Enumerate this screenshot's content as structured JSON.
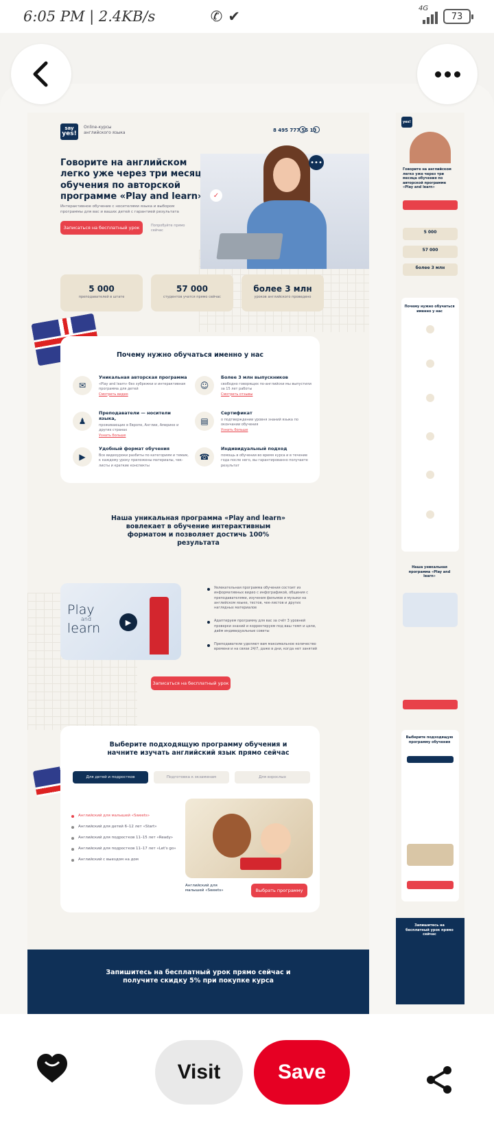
{
  "status_bar": {
    "time": "6:05 PM | 2.4KB/s",
    "network": "4G",
    "battery": "73"
  },
  "desktop": {
    "logo": {
      "top": "say",
      "bottom": "yes!"
    },
    "logo_text": "Online-курсы английского языка",
    "phone": "8 495 777 55 13",
    "hero_title": "Говорите на английском легко уже через три месяца обучения по авторской программе «Play and learn»",
    "hero_subtitle": "Интерактивное обучение с носителями языка и выбором программы для вас и ваших детей с гарантией результата",
    "hero_button": "Записаться на бесплатный урок",
    "hero_note": "Попробуйте прямо сейчас",
    "stats": [
      {
        "value": "5 000",
        "label": "преподавателей в штате"
      },
      {
        "value": "57 000",
        "label": "студентов учатся прямо сейчас"
      },
      {
        "value": "более 3 млн",
        "label": "уроков английского проведено"
      }
    ],
    "why_title": "Почему нужно обучаться именно у нас",
    "features": [
      {
        "title": "Уникальная авторская программа",
        "desc": "«Play and learn» без зубрежки и интерактивная программа для детей",
        "link": "Смотреть видео"
      },
      {
        "title": "Более 3 млн выпускников",
        "desc": "свободно говорящих по-английски мы выпустили за 15 лет работы",
        "link": "Смотреть отзывы"
      },
      {
        "title": "Преподаватели — носители языка,",
        "desc": "проживающие в Европе, Англии, Америке и других странах",
        "link": "Узнать больше"
      },
      {
        "title": "Сертификат",
        "desc": "о подтверждении уровня знаний языка по окончании обучения",
        "link": "Узнать больше"
      },
      {
        "title": "Удобный формат обучения",
        "desc": "Все видеоуроки разбиты по категориям и темам, к каждому уроку приложены материалы, чек-листы и краткие конспекты",
        "link": ""
      },
      {
        "title": "Индивидуальный подход",
        "desc": "помощь в обучении во время курса и в течение года после него, вы гарантированно получаете результат",
        "link": ""
      }
    ],
    "program_title": "Наша уникальная программа «Play and learn» вовлекает в обучение интерактивным форматом и позволяет достичь 100% результата",
    "play_card": {
      "line1": "Play",
      "line2": "and",
      "line3": "learn"
    },
    "program_points": [
      "Увлекательная программа обучения состоит из информативных видео с инфографикой, общения с преподавателями, изучения фильмов и музыки на английском языке, тестов, чек-листов и других наглядных материалов",
      "Адаптируем программу для вас за счёт 3 уровней проверки знаний и корректируем под ваш темп и цели, даём индивидуальные советы",
      "Преподаватели уделяют вам максимальное количество времени и на связи 24/7, даже в дни, когда нет занятий"
    ],
    "program_button": "Записаться на бесплатный урок",
    "choose_title": "Выберите подходящую программу обучения и начните изучать английский язык прямо сейчас",
    "tabs": [
      "Для детей и подростков",
      "Подготовка к экзаменам",
      "Для взрослых"
    ],
    "programs": [
      "Английский для малышей «Sweets»",
      "Английский для детей 6–12 лет «Start»",
      "Английский для подростков 11–15 лет «Ready»",
      "Английский для подростков 11–17 лет «Let's go»",
      "Английский с выездом на дом"
    ],
    "photo_caption": "Английский для малышей «Sweets»",
    "choose_button": "Выбрать программу",
    "footer_text": "Запишитесь на бесплатный урок прямо сейчас и получите скидку 5% при покупке курса"
  },
  "mobile": {
    "hero_title": "Говорите на английском легко уже через три месяца обучения по авторской программе «Play and learn»",
    "stats": [
      "5 000",
      "57 000",
      "более 3 млн"
    ],
    "why_title": "Почему нужно обучаться именно у нас",
    "program_title": "Наша уникальная программа «Play and learn»",
    "choose_title": "Выберите подходящую программу обучения",
    "footer_text": "Запишитесь на бесплатный урок прямо сейчас"
  },
  "actions": {
    "visit": "Visit",
    "save": "Save"
  },
  "colors": {
    "navy": "#0f3057",
    "red": "#e8414a",
    "pinterest_red": "#e60023",
    "beige": "#ebe3d2"
  }
}
